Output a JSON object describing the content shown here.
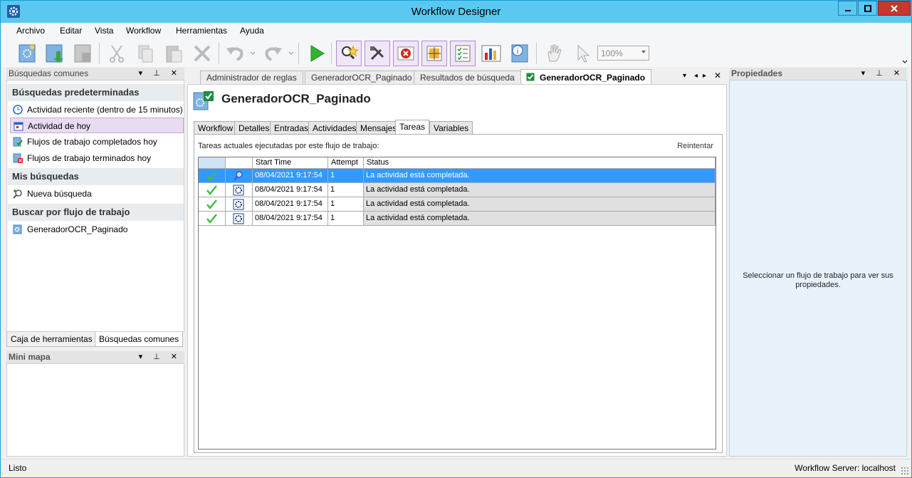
{
  "window": {
    "title": "Workflow Designer",
    "accent": "#5ac8f0",
    "close_color": "#c7362f"
  },
  "menu": [
    "Archivo",
    "Editar",
    "Vista",
    "Workflow",
    "Herramientas",
    "Ayuda"
  ],
  "toolbar": {
    "zoom": "100%"
  },
  "left_panel": {
    "title": "Búsquedas comunes",
    "sections": [
      {
        "title": "Búsquedas predeterminadas",
        "items": [
          "Actividad reciente (dentro de 15 minutos)",
          "Actividad de hoy",
          "Flujos de trabajo completados hoy",
          "Flujos de trabajo terminados hoy"
        ]
      },
      {
        "title": "Mis búsquedas",
        "items": [
          "Nueva búsqueda"
        ]
      },
      {
        "title": "Buscar por flujo de trabajo",
        "items": [
          "GeneradorOCR_Paginado"
        ]
      }
    ],
    "tabs": [
      "Caja de herramientas",
      "Búsquedas comunes"
    ]
  },
  "mini_panel": {
    "title": "Mini mapa"
  },
  "doc_tabs": [
    "Administrador de reglas",
    "GeneradorOCR_Paginado",
    "Resultados de búsqueda",
    "GeneradorOCR_Paginado"
  ],
  "doc": {
    "title": "GeneradorOCR_Paginado",
    "tabs": [
      "Workflow",
      "Detalles",
      "Entradas",
      "Actividades",
      "Mensajes",
      "Tareas",
      "Variables"
    ],
    "tasks_label": "Tareas actuales ejecutadas por este flujo de trabajo:",
    "retry": "Reintentar",
    "columns": [
      "Start Time",
      "Attempt",
      "Status"
    ],
    "rows": [
      {
        "start": "08/04/2021 9:17:54",
        "attempt": "1",
        "status": "La actividad está completada."
      },
      {
        "start": "08/04/2021 9:17:54",
        "attempt": "1",
        "status": "La actividad está completada."
      },
      {
        "start": "08/04/2021 9:17:54",
        "attempt": "1",
        "status": "La actividad está completada."
      },
      {
        "start": "08/04/2021 9:17:54",
        "attempt": "1",
        "status": "La actividad está completada."
      }
    ]
  },
  "right_panel": {
    "title": "Propiedades",
    "message": "Seleccionar un flujo de trabajo para ver sus propiedades."
  },
  "status": {
    "left": "Listo",
    "right": "Workflow Server: localhost"
  }
}
